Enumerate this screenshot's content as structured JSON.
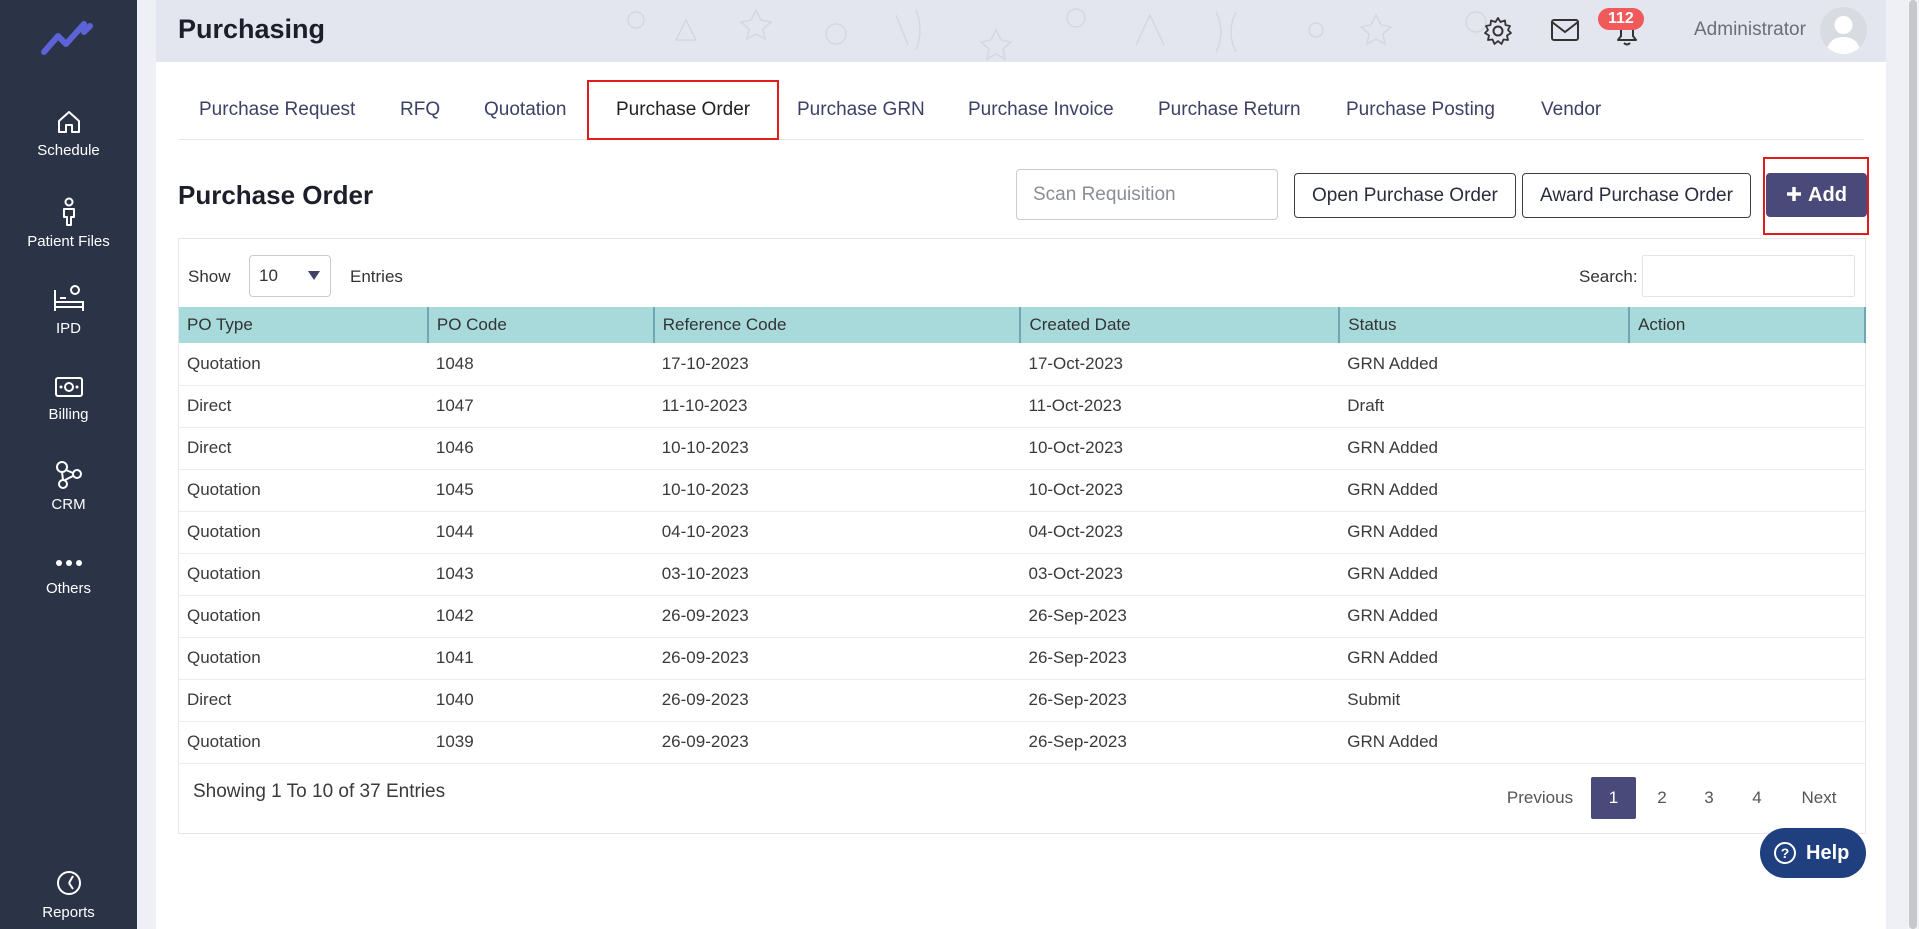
{
  "sidebar": {
    "items": [
      {
        "label": "Schedule",
        "icon": "home-icon"
      },
      {
        "label": "Patient Files",
        "icon": "person-icon"
      },
      {
        "label": "IPD",
        "icon": "bed-icon"
      },
      {
        "label": "Billing",
        "icon": "money-icon"
      },
      {
        "label": "CRM",
        "icon": "network-icon"
      },
      {
        "label": "Others",
        "icon": "dots-icon"
      },
      {
        "label": "Reports",
        "icon": "chart-pie-icon"
      }
    ]
  },
  "header": {
    "title": "Purchasing",
    "notification_count": "112",
    "user_name": "Administrator"
  },
  "tabs": [
    {
      "label": "Purchase Request"
    },
    {
      "label": "RFQ"
    },
    {
      "label": "Quotation"
    },
    {
      "label": "Purchase Order"
    },
    {
      "label": "Purchase GRN"
    },
    {
      "label": "Purchase Invoice"
    },
    {
      "label": "Purchase Return"
    },
    {
      "label": "Purchase Posting"
    },
    {
      "label": "Vendor"
    }
  ],
  "section": {
    "title": "Purchase Order",
    "scan_placeholder": "Scan Requisition",
    "open_po_label": "Open Purchase Order",
    "award_po_label": "Award Purchase Order",
    "add_label": "Add"
  },
  "table_controls": {
    "show_label": "Show",
    "entries_value": "10",
    "entries_label": "Entries",
    "search_label": "Search:"
  },
  "table": {
    "columns": [
      "PO Type",
      "PO Code",
      "Reference Code",
      "Created Date",
      "Status",
      "Action"
    ],
    "rows": [
      [
        "Quotation",
        "1048",
        "17-10-2023",
        "17-Oct-2023",
        "GRN Added",
        ""
      ],
      [
        "Direct",
        "1047",
        "11-10-2023",
        "11-Oct-2023",
        "Draft",
        ""
      ],
      [
        "Direct",
        "1046",
        "10-10-2023",
        "10-Oct-2023",
        "GRN Added",
        ""
      ],
      [
        "Quotation",
        "1045",
        "10-10-2023",
        "10-Oct-2023",
        "GRN Added",
        ""
      ],
      [
        "Quotation",
        "1044",
        "04-10-2023",
        "04-Oct-2023",
        "GRN Added",
        ""
      ],
      [
        "Quotation",
        "1043",
        "03-10-2023",
        "03-Oct-2023",
        "GRN Added",
        ""
      ],
      [
        "Quotation",
        "1042",
        "26-09-2023",
        "26-Sep-2023",
        "GRN Added",
        ""
      ],
      [
        "Quotation",
        "1041",
        "26-09-2023",
        "26-Sep-2023",
        "GRN Added",
        ""
      ],
      [
        "Direct",
        "1040",
        "26-09-2023",
        "26-Sep-2023",
        "Submit",
        ""
      ],
      [
        "Quotation",
        "1039",
        "26-09-2023",
        "26-Sep-2023",
        "GRN Added",
        ""
      ]
    ]
  },
  "footer": {
    "showing_text": "Showing 1 To 10 of 37 Entries",
    "pagination": [
      "Previous",
      "1",
      "2",
      "3",
      "4",
      "Next"
    ]
  },
  "help": {
    "label": "Help"
  },
  "colors": {
    "sidebar": "#2b3347",
    "accent": "#4a4a7a",
    "table_header": "#a9dadb",
    "highlight": "#e41b1b",
    "badge": "#f05a5a",
    "help": "#1f3f7f"
  }
}
